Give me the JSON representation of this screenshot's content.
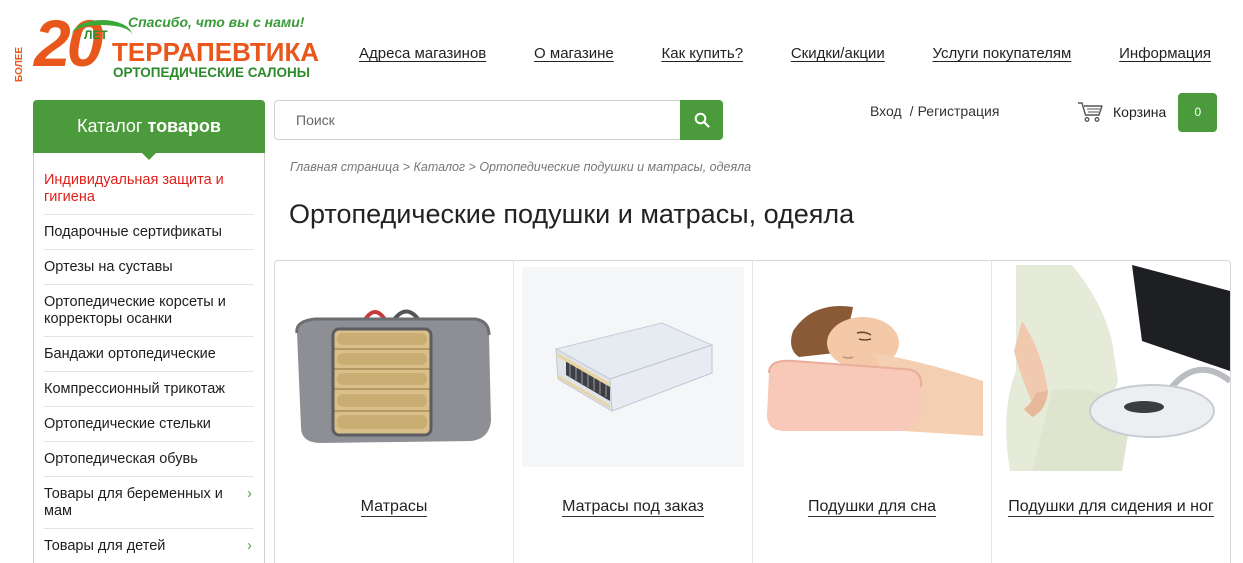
{
  "logo": {
    "years": "20",
    "bolee": "БОЛЕЕ",
    "let": "ЛЕТ",
    "slogan": "Спасибо, что вы с нами!",
    "name": "ТЕРРАПЕВТИКА",
    "subtitle": "ОРТОПЕДИЧЕСКИЕ САЛОНЫ"
  },
  "topnav": [
    {
      "label": "Адреса магазинов"
    },
    {
      "label": "О магазине"
    },
    {
      "label": "Как купить?"
    },
    {
      "label": "Скидки/акции"
    },
    {
      "label": "Услуги покупателям"
    },
    {
      "label": "Информация"
    }
  ],
  "catalog": {
    "title_normal": "Каталог",
    "title_bold": "товаров",
    "items": [
      {
        "label": "Индивидуальная защита и гигиена",
        "active": true
      },
      {
        "label": "Подарочные сертификаты"
      },
      {
        "label": "Ортезы на суставы"
      },
      {
        "label": "Ортопедические корсеты и корректоры осанки"
      },
      {
        "label": "Бандажи ортопедические"
      },
      {
        "label": "Компрессионный трикотаж"
      },
      {
        "label": "Ортопедические стельки"
      },
      {
        "label": "Ортопедическая обувь"
      },
      {
        "label": "Товары для беременных и мам",
        "submenu": true
      },
      {
        "label": "Товары для детей",
        "submenu": true
      }
    ],
    "chevron": "›"
  },
  "search": {
    "placeholder": "Поиск"
  },
  "account": {
    "login": "Вход",
    "separator": "/",
    "register": "Регистрация"
  },
  "cart": {
    "label": "Корзина",
    "count": "0"
  },
  "breadcrumb": "Главная страница > Каталог > Ортопедические подушки и матрасы, одеяла",
  "page_title": "Ортопедические подушки и матрасы, одеяла",
  "products": [
    {
      "name": "Матрасы"
    },
    {
      "name": "Матрасы под заказ"
    },
    {
      "name": "Подушки для сна"
    },
    {
      "name": "Подушки для сидения и ног"
    }
  ],
  "colors": {
    "brand_green": "#4b9a3b",
    "brand_orange": "#e8581c",
    "active_red": "#e0201a"
  }
}
